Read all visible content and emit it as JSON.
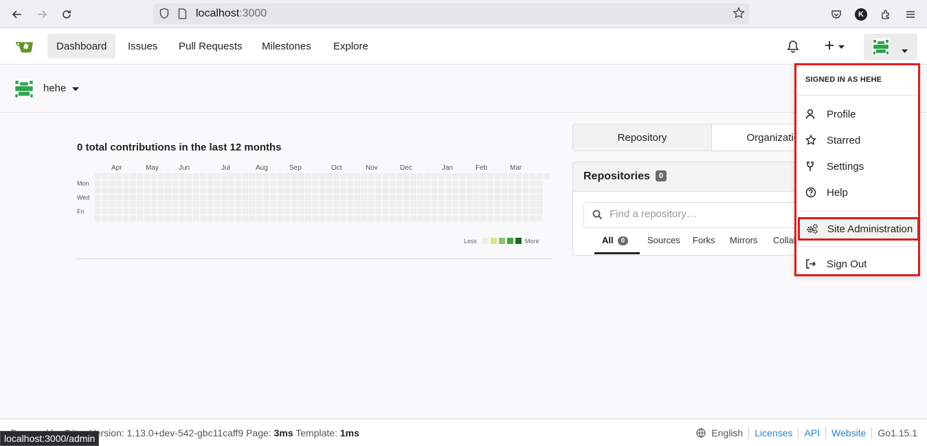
{
  "browser": {
    "url_host": "localhost",
    "url_port": ":3000",
    "account_initial": "K",
    "status_url": "localhost:3000/admin"
  },
  "header": {
    "nav": [
      "Dashboard",
      "Issues",
      "Pull Requests",
      "Milestones",
      "Explore"
    ],
    "active_nav": "Dashboard"
  },
  "user": {
    "name": "hehe"
  },
  "heatmap": {
    "title": "0 total contributions in the last 12 months",
    "months": [
      "Apr",
      "May",
      "Jun",
      "Jul",
      "Aug",
      "Sep",
      "Oct",
      "Nov",
      "Dec",
      "Jan",
      "Feb",
      "Mar"
    ],
    "days": [
      "Mon",
      "Wed",
      "Fri"
    ],
    "less_label": "Less",
    "more_label": "More",
    "legend_colors": [
      "#eeeeee",
      "#d6e685",
      "#8cc665",
      "#44a340",
      "#1e6823"
    ],
    "contributions": 0
  },
  "repo_panel": {
    "tabs": [
      "Repository",
      "Organization"
    ],
    "title": "Repositories",
    "count": "0",
    "search_placeholder": "Find a repository…",
    "filters": [
      "All",
      "Sources",
      "Forks",
      "Mirrors",
      "Collaborative"
    ],
    "all_count": "0"
  },
  "dropdown": {
    "header_prefix": "SIGNED IN AS ",
    "header_user": "HEHE",
    "items": [
      "Profile",
      "Starred",
      "Settings",
      "Help"
    ],
    "admin": "Site Administration",
    "signout": "Sign Out"
  },
  "footer": {
    "version_text": "Powered by Gitea Version: 1.13.0+dev-542-gbc11caff9 Page: ",
    "page_time": "3ms",
    "template_label": " Template: ",
    "template_time": "1ms",
    "language": "English",
    "links": [
      "Licenses",
      "API",
      "Website"
    ],
    "go_version": "Go1.15.1"
  },
  "colors": {
    "accent": "#e21b1b",
    "gitea_green": "#609926",
    "link": "#2185d0"
  }
}
